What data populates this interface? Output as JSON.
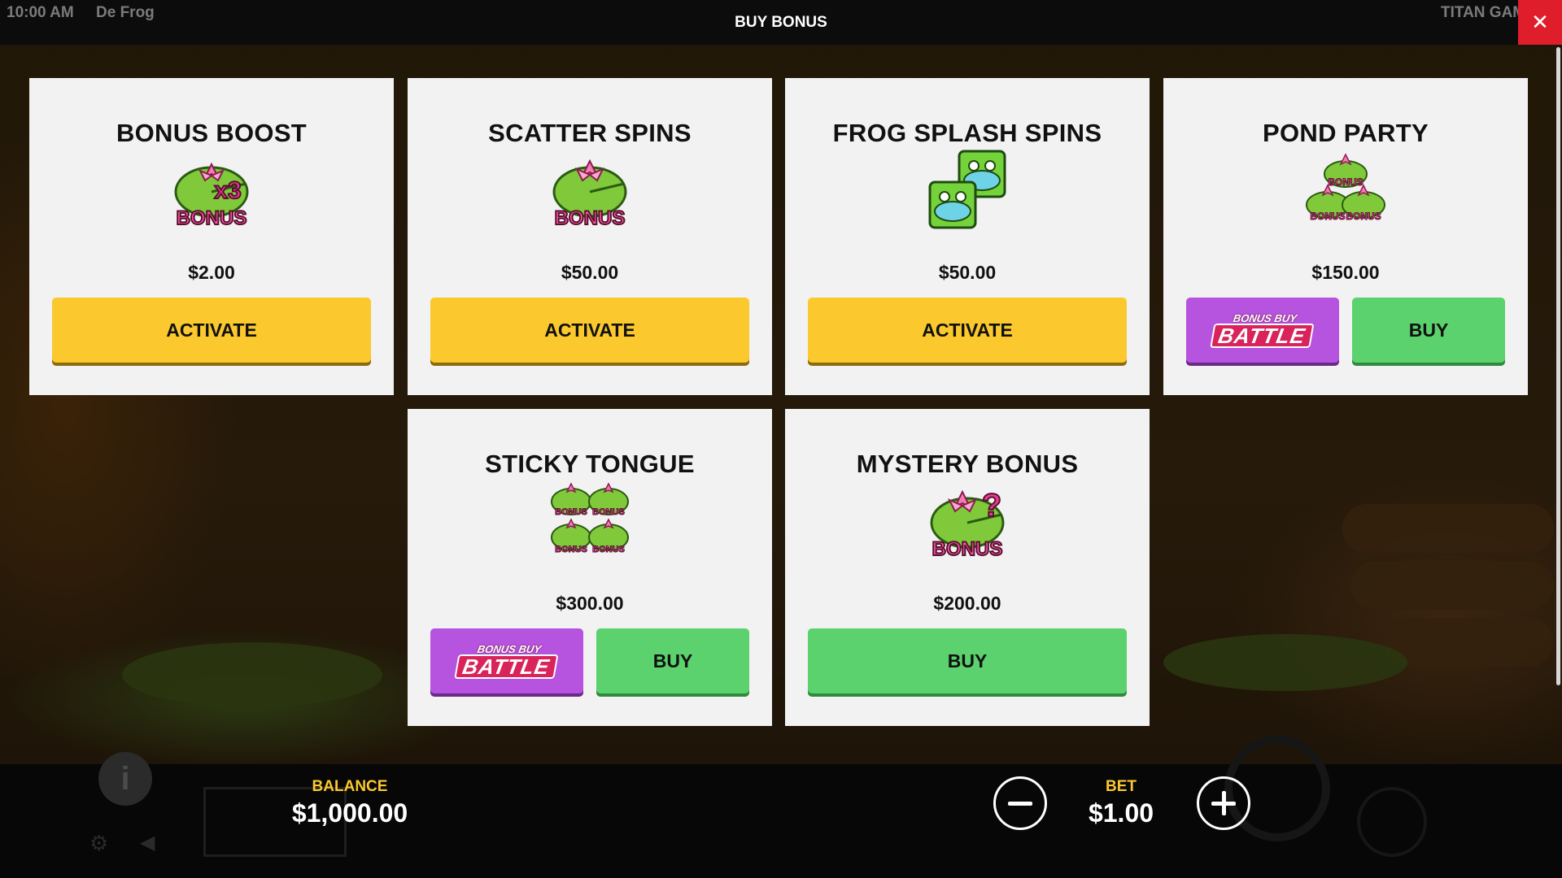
{
  "topbar": {
    "clock": "10:00 AM",
    "game_name": "De Frog",
    "title": "BUY BONUS",
    "brand": "TITAN GAMING",
    "close_icon": "close-x-icon"
  },
  "cards": [
    {
      "title": "BONUS BOOST",
      "icon": "lily-pad-x3-bonus-icon",
      "icon_text": "x3",
      "price": "$2.00",
      "button": "ACTIVATE"
    },
    {
      "title": "SCATTER SPINS",
      "icon": "lily-pad-bonus-icon",
      "price": "$50.00",
      "button": "ACTIVATE"
    },
    {
      "title": "FROG SPLASH SPINS",
      "icon": "frog-tiles-icon",
      "price": "$50.00",
      "button": "ACTIVATE"
    },
    {
      "title": "POND PARTY",
      "icon": "triple-lily-pad-bonus-icon",
      "price": "$150.00",
      "battle_button": "BONUS BUY BATTLE",
      "button": "BUY"
    },
    {
      "title": "STICKY TONGUE",
      "icon": "quad-lily-pad-bonus-icon",
      "price": "$300.00",
      "battle_button": "BONUS BUY BATTLE",
      "button": "BUY"
    },
    {
      "title": "MYSTERY BONUS",
      "icon": "lily-pad-mystery-bonus-icon",
      "icon_text": "?",
      "price": "$200.00",
      "button": "BUY"
    }
  ],
  "battle_logo": {
    "small": "BONUS BUY",
    "big": "BATTLE"
  },
  "icon_word": "BONUS",
  "bottombar": {
    "balance_label": "BALANCE",
    "balance_value": "$1,000.00",
    "bet_label": "BET",
    "bet_value": "$1.00",
    "minus_icon": "minus-icon",
    "plus_icon": "plus-icon"
  },
  "colors": {
    "activate": "#fbc92d",
    "buy": "#5bd26d",
    "battle": "#b654e0",
    "close": "#e01e2b",
    "label": "#fbc92d"
  }
}
